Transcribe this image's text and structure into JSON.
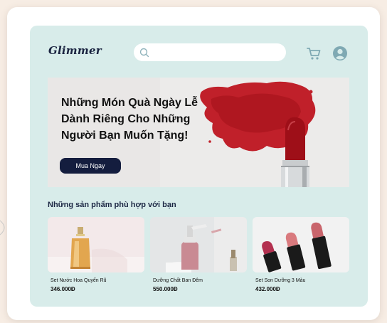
{
  "app": {
    "logo": "Glimmer",
    "search": {
      "placeholder": "",
      "value": ""
    }
  },
  "hero": {
    "line1": "Những Món Quà Ngày Lễ",
    "line2": "Dành Riêng Cho Những",
    "line3": "Người Bạn Muốn Tặng!",
    "button_label": "Mua Ngay"
  },
  "recommend": {
    "title": "Những sản phẩm phù hợp với bạn",
    "items": [
      {
        "name": "Set Nước Hoa Quyến Rũ",
        "price": "346.000Đ"
      },
      {
        "name": "Dưỡng Chất Ban Đêm",
        "price": "550.000Đ"
      },
      {
        "name": "Set Son Dưỡng 3 Màu",
        "price": "432.000Đ"
      }
    ]
  },
  "colors": {
    "app_bg": "#d8ecea",
    "button_bg": "#141d3e",
    "lipstick_red": "#b3141c",
    "icon_color": "#7fa9b3"
  },
  "icons": [
    "search-icon",
    "cart-icon",
    "user-icon"
  ]
}
